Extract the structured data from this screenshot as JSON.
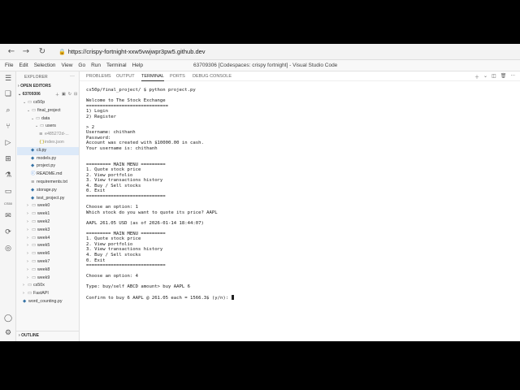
{
  "browser": {
    "back": "←",
    "forward": "→",
    "reload": "↻",
    "url": "https://crispy-fortnight-xxw5vwjwpr3pw5.github.dev"
  },
  "menu": {
    "items": [
      "File",
      "Edit",
      "Selection",
      "View",
      "Go",
      "Run",
      "Terminal",
      "Help"
    ],
    "window_title": "63709306 [Codespaces: crispy fortnight] - Visual Studio Code"
  },
  "activity": {
    "label": "CS50"
  },
  "sidebar": {
    "title": "EXPLORER",
    "open_editors": "OPEN EDITORS",
    "workspace": "63709306",
    "outline": "OUTLINE",
    "tree": [
      {
        "label": "cs50p",
        "type": "folder",
        "open": true,
        "depth": 1
      },
      {
        "label": "final_project",
        "type": "folder",
        "open": true,
        "depth": 2
      },
      {
        "label": "data",
        "type": "folder",
        "open": true,
        "depth": 3
      },
      {
        "label": "users",
        "type": "folder",
        "open": true,
        "depth": 4
      },
      {
        "label": "e485272d-...",
        "type": "file",
        "ext": "txt",
        "depth": 5,
        "dim": true
      },
      {
        "label": "index.json",
        "type": "file",
        "ext": "json",
        "depth": 5,
        "dim": true
      },
      {
        "label": "cli.py",
        "type": "file",
        "ext": "py",
        "depth": 3,
        "selected": true
      },
      {
        "label": "models.py",
        "type": "file",
        "ext": "py",
        "depth": 3
      },
      {
        "label": "project.py",
        "type": "file",
        "ext": "py",
        "depth": 3
      },
      {
        "label": "README.md",
        "type": "file",
        "ext": "md",
        "depth": 3
      },
      {
        "label": "requirements.txt",
        "type": "file",
        "ext": "txt",
        "depth": 3
      },
      {
        "label": "storage.py",
        "type": "file",
        "ext": "py",
        "depth": 3
      },
      {
        "label": "test_project.py",
        "type": "file",
        "ext": "py",
        "depth": 3
      },
      {
        "label": "week0",
        "type": "folder",
        "open": false,
        "depth": 2
      },
      {
        "label": "week1",
        "type": "folder",
        "open": false,
        "depth": 2
      },
      {
        "label": "week2",
        "type": "folder",
        "open": false,
        "depth": 2
      },
      {
        "label": "week3",
        "type": "folder",
        "open": false,
        "depth": 2
      },
      {
        "label": "week4",
        "type": "folder",
        "open": false,
        "depth": 2
      },
      {
        "label": "week5",
        "type": "folder",
        "open": false,
        "depth": 2
      },
      {
        "label": "week6",
        "type": "folder",
        "open": false,
        "depth": 2
      },
      {
        "label": "week7",
        "type": "folder",
        "open": false,
        "depth": 2
      },
      {
        "label": "week8",
        "type": "folder",
        "open": false,
        "depth": 2
      },
      {
        "label": "week9",
        "type": "folder",
        "open": false,
        "depth": 2
      },
      {
        "label": "cs50x",
        "type": "folder",
        "open": false,
        "depth": 1
      },
      {
        "label": "FastAPI",
        "type": "folder",
        "open": false,
        "depth": 1
      },
      {
        "label": "word_counting.py",
        "type": "file",
        "ext": "py",
        "depth": 1
      }
    ]
  },
  "panel": {
    "tabs": [
      "PROBLEMS",
      "OUTPUT",
      "TERMINAL",
      "PORTS",
      "DEBUG CONSOLE"
    ],
    "active_tab": "TERMINAL"
  },
  "terminal": {
    "lines": [
      "cs50p/final_project/ $ python project.py",
      "",
      "Welcome to The Stock Exchange",
      "==============================",
      "1) Login",
      "2) Register",
      "",
      "> 2",
      "Username: chithanh",
      "Password:",
      "Account was created with $10000.00 in cash.",
      "Your username is: chithanh",
      "",
      "",
      "========= MAIN MENU =========",
      "1. Quote stock price",
      "2. View portfolio",
      "3. View transactions history",
      "4. Buy / Sell stocks",
      "0. Exit",
      "=============================",
      "",
      "Choose an option: 1",
      "Which stock do you want to quote its price? AAPL",
      "",
      "AAPL 261.05 USD (as of 2026-01-14 18:44:07)",
      "",
      "========= MAIN MENU =========",
      "1. Quote stock price",
      "2. View portfolio",
      "3. View transactions history",
      "4. Buy / Sell stocks",
      "0. Exit",
      "=============================",
      "",
      "Choose an option: 4",
      "",
      "Type: buy/self ABCD amount> buy AAPL 6",
      "",
      "Confirm to buy 6 AAPL @ 261.05 each = 1566.3$ (y/n): "
    ]
  }
}
